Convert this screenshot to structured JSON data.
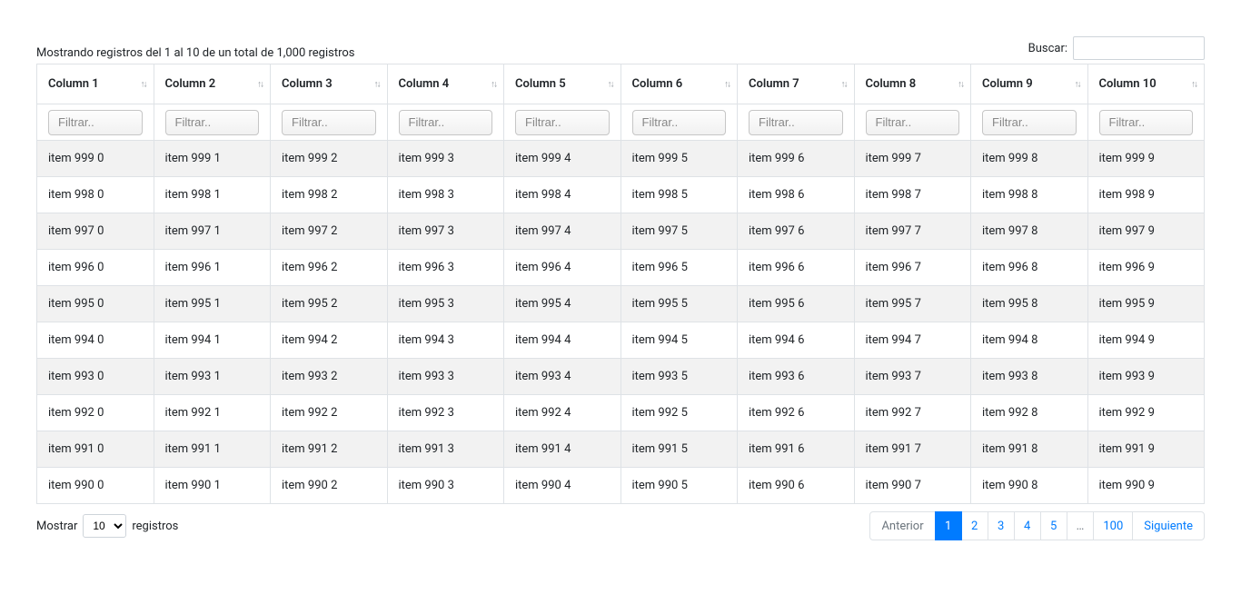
{
  "info_text": "Mostrando registros del 1 al 10 de un total de 1,000 registros",
  "search": {
    "label": "Buscar:",
    "value": ""
  },
  "columns": [
    "Column 1",
    "Column 2",
    "Column 3",
    "Column 4",
    "Column 5",
    "Column 6",
    "Column 7",
    "Column 8",
    "Column 9",
    "Column 10"
  ],
  "filter_placeholder": "Filtrar..",
  "rows": [
    [
      "item 999 0",
      "item 999 1",
      "item 999 2",
      "item 999 3",
      "item 999 4",
      "item 999 5",
      "item 999 6",
      "item 999 7",
      "item 999 8",
      "item 999 9"
    ],
    [
      "item 998 0",
      "item 998 1",
      "item 998 2",
      "item 998 3",
      "item 998 4",
      "item 998 5",
      "item 998 6",
      "item 998 7",
      "item 998 8",
      "item 998 9"
    ],
    [
      "item 997 0",
      "item 997 1",
      "item 997 2",
      "item 997 3",
      "item 997 4",
      "item 997 5",
      "item 997 6",
      "item 997 7",
      "item 997 8",
      "item 997 9"
    ],
    [
      "item 996 0",
      "item 996 1",
      "item 996 2",
      "item 996 3",
      "item 996 4",
      "item 996 5",
      "item 996 6",
      "item 996 7",
      "item 996 8",
      "item 996 9"
    ],
    [
      "item 995 0",
      "item 995 1",
      "item 995 2",
      "item 995 3",
      "item 995 4",
      "item 995 5",
      "item 995 6",
      "item 995 7",
      "item 995 8",
      "item 995 9"
    ],
    [
      "item 994 0",
      "item 994 1",
      "item 994 2",
      "item 994 3",
      "item 994 4",
      "item 994 5",
      "item 994 6",
      "item 994 7",
      "item 994 8",
      "item 994 9"
    ],
    [
      "item 993 0",
      "item 993 1",
      "item 993 2",
      "item 993 3",
      "item 993 4",
      "item 993 5",
      "item 993 6",
      "item 993 7",
      "item 993 8",
      "item 993 9"
    ],
    [
      "item 992 0",
      "item 992 1",
      "item 992 2",
      "item 992 3",
      "item 992 4",
      "item 992 5",
      "item 992 6",
      "item 992 7",
      "item 992 8",
      "item 992 9"
    ],
    [
      "item 991 0",
      "item 991 1",
      "item 991 2",
      "item 991 3",
      "item 991 4",
      "item 991 5",
      "item 991 6",
      "item 991 7",
      "item 991 8",
      "item 991 9"
    ],
    [
      "item 990 0",
      "item 990 1",
      "item 990 2",
      "item 990 3",
      "item 990 4",
      "item 990 5",
      "item 990 6",
      "item 990 7",
      "item 990 8",
      "item 990 9"
    ]
  ],
  "length": {
    "prefix": "Mostrar",
    "suffix": "registros",
    "options": [
      "10"
    ],
    "selected": "10"
  },
  "pagination": {
    "prev": "Anterior",
    "next": "Siguiente",
    "pages": [
      {
        "label": "1",
        "active": true,
        "type": "page"
      },
      {
        "label": "2",
        "active": false,
        "type": "page"
      },
      {
        "label": "3",
        "active": false,
        "type": "page"
      },
      {
        "label": "4",
        "active": false,
        "type": "page"
      },
      {
        "label": "5",
        "active": false,
        "type": "page"
      },
      {
        "label": "…",
        "active": false,
        "type": "ellipsis"
      },
      {
        "label": "100",
        "active": false,
        "type": "page"
      }
    ]
  }
}
